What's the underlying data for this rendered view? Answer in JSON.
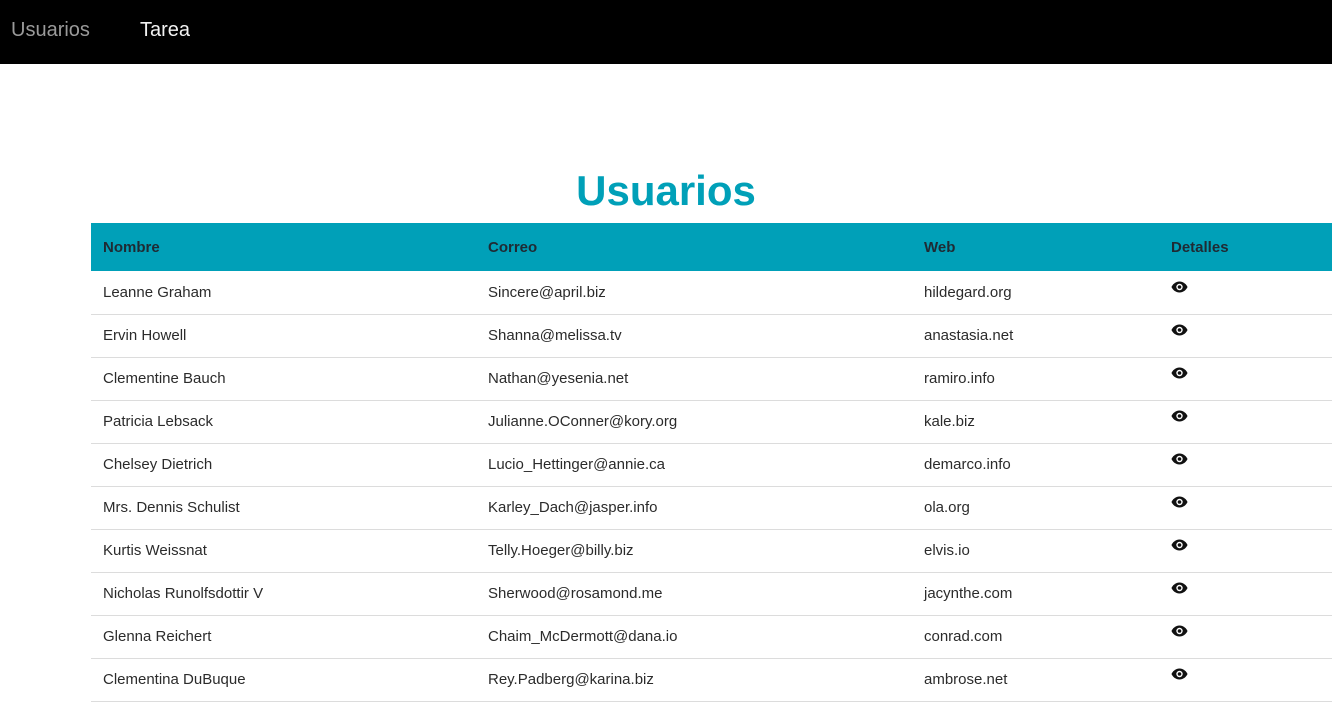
{
  "nav": {
    "items": [
      {
        "label": "Usuarios"
      },
      {
        "label": "Tarea"
      }
    ]
  },
  "main": {
    "title": "Usuarios",
    "columns": [
      "Nombre",
      "Correo",
      "Web",
      "Detalles"
    ],
    "rows": [
      {
        "name": "Leanne Graham",
        "email": "Sincere@april.biz",
        "web": "hildegard.org",
        "icon": "eye-icon"
      },
      {
        "name": "Ervin Howell",
        "email": "Shanna@melissa.tv",
        "web": "anastasia.net",
        "icon": "eye-icon"
      },
      {
        "name": "Clementine Bauch",
        "email": "Nathan@yesenia.net",
        "web": "ramiro.info",
        "icon": "eye-icon"
      },
      {
        "name": "Patricia Lebsack",
        "email": "Julianne.OConner@kory.org",
        "web": "kale.biz",
        "icon": "eye-icon"
      },
      {
        "name": "Chelsey Dietrich",
        "email": "Lucio_Hettinger@annie.ca",
        "web": "demarco.info",
        "icon": "eye-icon"
      },
      {
        "name": "Mrs. Dennis Schulist",
        "email": "Karley_Dach@jasper.info",
        "web": "ola.org",
        "icon": "eye-icon"
      },
      {
        "name": "Kurtis Weissnat",
        "email": "Telly.Hoeger@billy.biz",
        "web": "elvis.io",
        "icon": "eye-icon"
      },
      {
        "name": "Nicholas Runolfsdottir V",
        "email": "Sherwood@rosamond.me",
        "web": "jacynthe.com",
        "icon": "eye-icon"
      },
      {
        "name": "Glenna Reichert",
        "email": "Chaim_McDermott@dana.io",
        "web": "conrad.com",
        "icon": "eye-icon"
      },
      {
        "name": "Clementina DuBuque",
        "email": "Rey.Padberg@karina.biz",
        "web": "ambrose.net",
        "icon": "eye-icon"
      }
    ]
  },
  "colors": {
    "navbar": "#000000",
    "accent": "#00a0b8",
    "nav_active": "#9a9a9a",
    "nav_inactive": "#f2f2f2"
  }
}
